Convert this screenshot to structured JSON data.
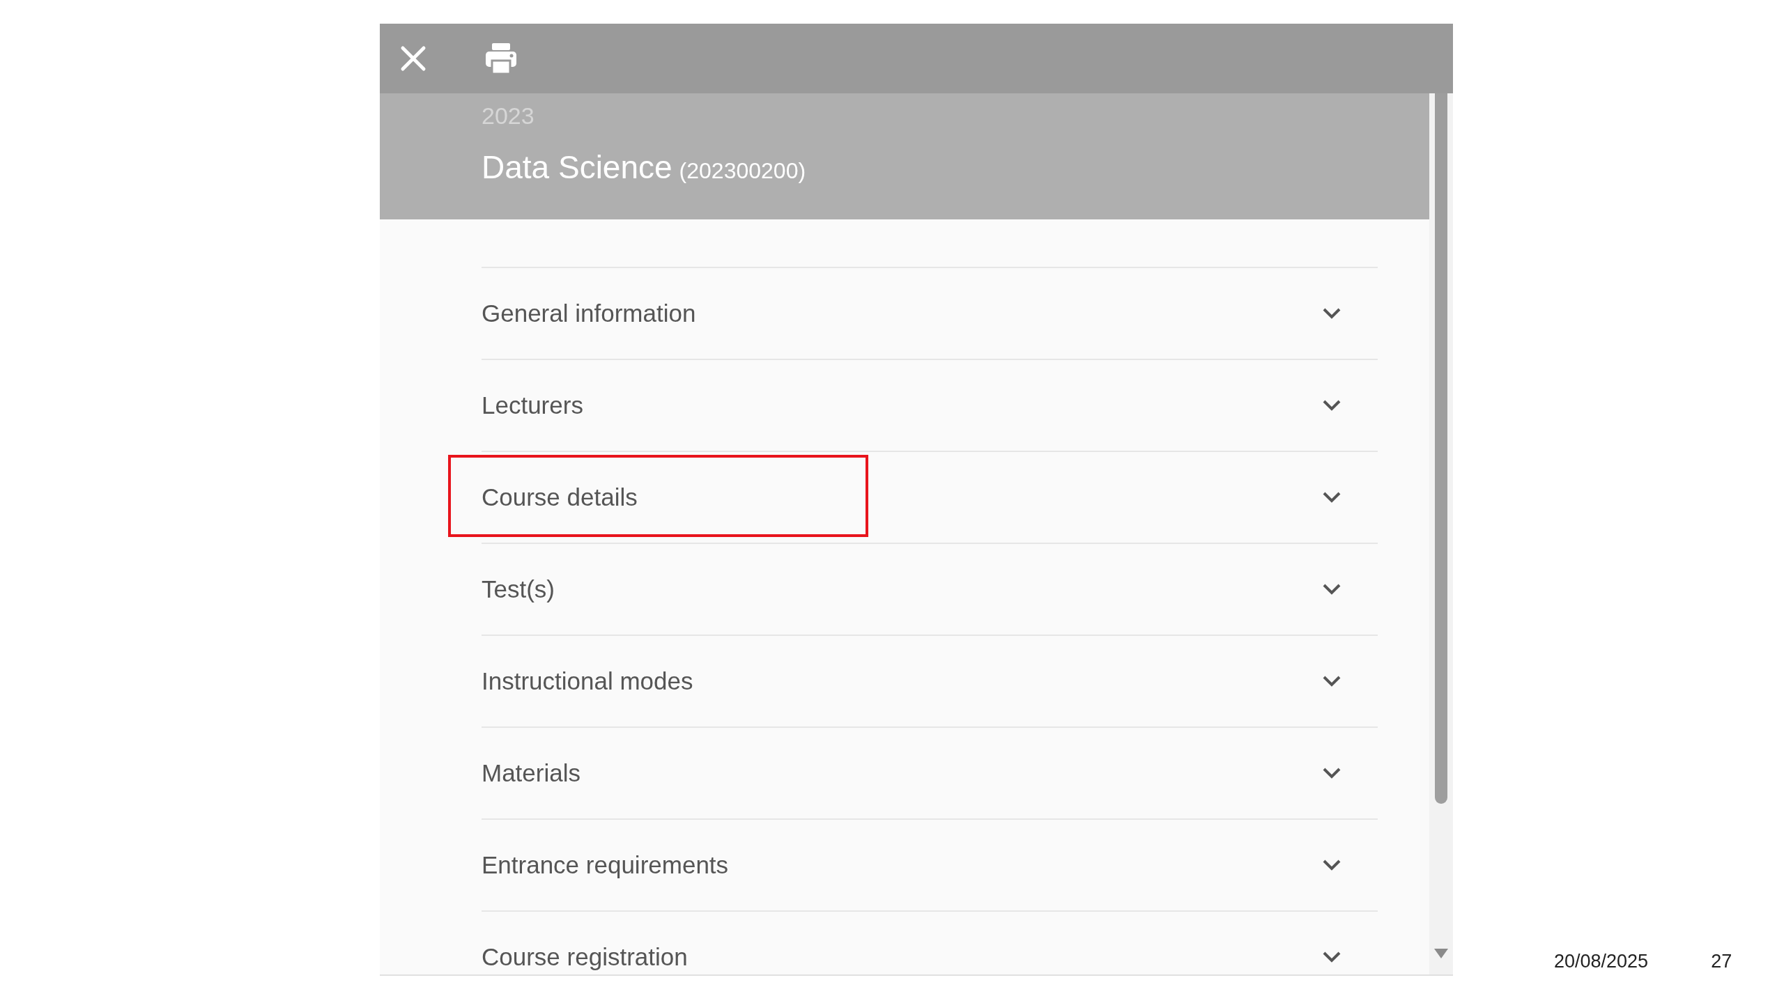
{
  "toolbar": {
    "buttons": [
      {
        "kind": "close"
      },
      {
        "kind": "print"
      }
    ]
  },
  "header": {
    "year": "2023",
    "title": "Data Science",
    "code": "(202300200)"
  },
  "sections": [
    {
      "label": "General information",
      "expanded": false,
      "highlighted": false
    },
    {
      "label": "Lecturers",
      "expanded": false,
      "highlighted": false
    },
    {
      "label": "Course details",
      "expanded": false,
      "highlighted": true
    },
    {
      "label": "Test(s)",
      "expanded": false,
      "highlighted": false
    },
    {
      "label": "Instructional modes",
      "expanded": false,
      "highlighted": false
    },
    {
      "label": "Materials",
      "expanded": false,
      "highlighted": false
    },
    {
      "label": "Entrance requirements",
      "expanded": false,
      "highlighted": false
    },
    {
      "label": "Course registration",
      "expanded": false,
      "highlighted": false
    }
  ],
  "slide_footer": {
    "date": "20/08/2025",
    "page": "27"
  }
}
